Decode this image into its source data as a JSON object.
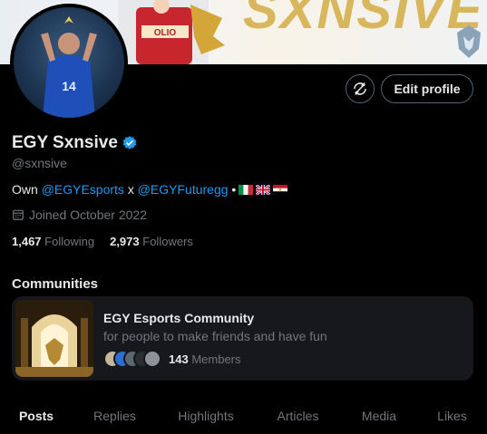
{
  "banner": {
    "text": "SXNSIVE"
  },
  "profile": {
    "display_name": "EGY Sxnsive",
    "handle": "@sxnsive",
    "bio_prefix": "Own",
    "bio_mention_1": "@EGYEsports",
    "bio_separator": "x",
    "bio_mention_2": "@EGYFuturegg",
    "bio_bullet": "•",
    "joined": "Joined October 2022",
    "following_count": "1,467",
    "following_label": "Following",
    "followers_count": "2,973",
    "followers_label": "Followers"
  },
  "actions": {
    "edit_profile": "Edit profile"
  },
  "communities": {
    "title": "Communities",
    "items": [
      {
        "name": "EGY Esports Community",
        "description": "for people to make friends and have fun",
        "member_count": "143",
        "member_label": "Members"
      }
    ]
  },
  "tabs": [
    "Posts",
    "Replies",
    "Highlights",
    "Articles",
    "Media",
    "Likes"
  ],
  "colors": {
    "accent": "#1d9bf0",
    "text": "#e7e9ea",
    "muted": "#71767b",
    "card": "#16181c",
    "border": "#536471"
  },
  "icons": [
    "verified-badge-icon",
    "refresh-icon",
    "calendar-icon",
    "flag-italy-icon",
    "flag-uk-icon",
    "flag-egypt-icon"
  ]
}
